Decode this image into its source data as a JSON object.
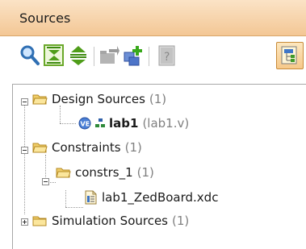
{
  "panel": {
    "title": "Sources"
  },
  "toolbar": {
    "icons": [
      "search-icon",
      "collapse-all-icon",
      "expand-all-icon",
      "open-file-icon",
      "add-sources-icon",
      "properties-icon",
      "hierarchy-update-icon"
    ]
  },
  "tree": {
    "design_sources": {
      "label": "Design Sources",
      "count": "(1)"
    },
    "lab1": {
      "label": "lab1",
      "file": "(lab1.v)"
    },
    "constraints": {
      "label": "Constraints",
      "count": "(1)"
    },
    "constrs_1": {
      "label": "constrs_1",
      "count": "(1)"
    },
    "xdc": {
      "label": "lab1_ZedBoard.xdc"
    },
    "simulation_sources": {
      "label": "Simulation Sources",
      "count": "(1)"
    }
  }
}
